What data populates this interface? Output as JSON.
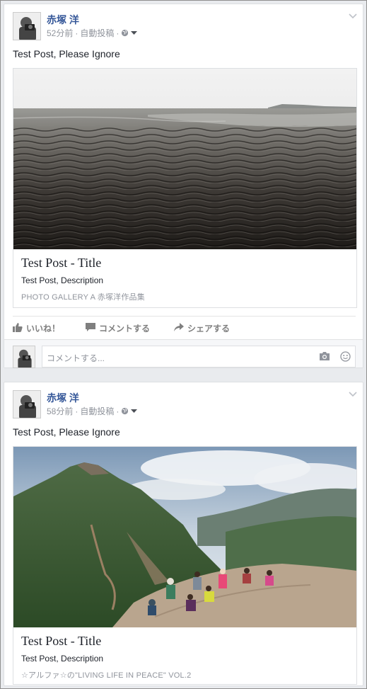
{
  "posts": [
    {
      "author": "赤塚 洋",
      "timestamp": "52分前",
      "separator1": "·",
      "post_type": "自動投稿",
      "separator2": "·",
      "privacy_icon": "globe-icon",
      "status_text": "Test Post, Please Ignore",
      "link": {
        "image": "tidal-flat-landscape",
        "title": "Test Post - Title",
        "description": "Test Post, Description",
        "source": "PHOTO GALLERY A 赤塚洋作品集"
      },
      "actions": {
        "like_label": "いいね！",
        "comment_label": "コメントする",
        "share_label": "シェアする"
      },
      "comment_placeholder": "コメントする..."
    },
    {
      "author": "赤塚 洋",
      "timestamp": "58分前",
      "separator1": "·",
      "post_type": "自動投稿",
      "separator2": "·",
      "privacy_icon": "globe-icon",
      "status_text": "Test Post, Please Ignore",
      "link": {
        "image": "mountain-hikers-landscape",
        "title": "Test Post - Title",
        "description": "Test Post, Description",
        "source": "☆アルファ☆の\"LIVING LIFE IN PEACE\" VOL.2"
      }
    }
  ],
  "colors": {
    "author_link": "#365899",
    "meta_gray": "#90949c",
    "action_gray": "#7f7f7f",
    "feed_bg": "#e9ebee"
  }
}
